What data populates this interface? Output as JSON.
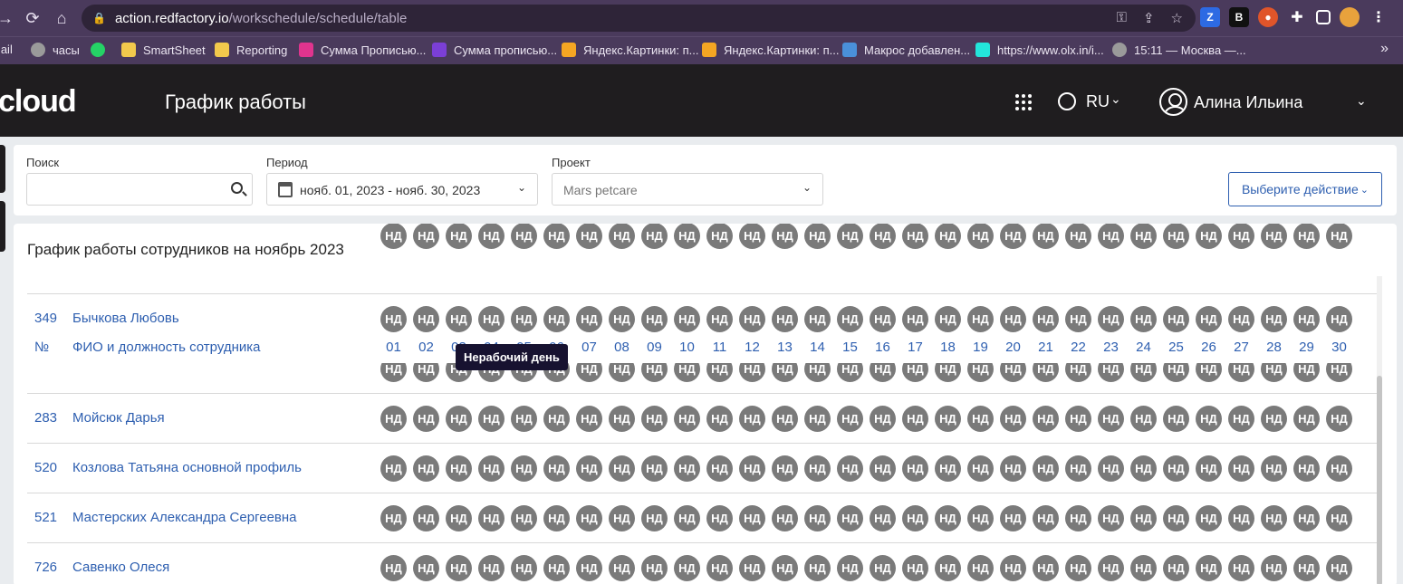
{
  "browser": {
    "url_host": "action.redfactory.io",
    "url_path": "/workschedule/schedule/table",
    "bookmarks": [
      {
        "label": "mail",
        "icon": "mail-icon",
        "color": "#4a3a5c"
      },
      {
        "label": "часы",
        "icon": "clock-icon",
        "color": "#9a9a9a"
      },
      {
        "label": "",
        "icon": "whatsapp-icon",
        "color": "#25d366"
      },
      {
        "label": "SmartSheet",
        "icon": "folder-icon",
        "color": "#f2c94c"
      },
      {
        "label": "Reporting",
        "icon": "folder-icon",
        "color": "#f2c94c"
      },
      {
        "label": "Сумма Прописью...",
        "icon": "sum-icon",
        "color": "#e0348e"
      },
      {
        "label": "Сумма прописью...",
        "icon": "sum-icon",
        "color": "#7b3fd6"
      },
      {
        "label": "Яндекс.Картинки: п...",
        "icon": "yandex-images-icon",
        "color": "#f5a623"
      },
      {
        "label": "Яндекс.Картинки: п...",
        "icon": "yandex-images-icon",
        "color": "#f5a623"
      },
      {
        "label": "Макрос добавлен...",
        "icon": "macro-icon",
        "color": "#4a90d9"
      },
      {
        "label": "https://www.olx.in/i...",
        "icon": "olx-icon",
        "color": "#23e5db"
      },
      {
        "label": "15:11 — Москва —...",
        "icon": "clock-icon",
        "color": "#9a9a9a"
      }
    ],
    "more": "»"
  },
  "header": {
    "logo": "cloud",
    "title": "График работы",
    "lang": "RU",
    "user": "Алина Ильина"
  },
  "filters": {
    "search_label": "Поиск",
    "search_value": "",
    "period_label": "Период",
    "period_value": "нояб. 01, 2023 - нояб. 30, 2023",
    "project_label": "Проект",
    "project_value": "Mars petcare",
    "action_label": "Выберите действие"
  },
  "table": {
    "title": "График работы сотрудников на ноябрь 2023",
    "col_num": "№",
    "col_name": "ФИО и должность сотрудника",
    "days": [
      "01",
      "02",
      "03",
      "04",
      "05",
      "06",
      "07",
      "08",
      "09",
      "10",
      "11",
      "12",
      "13",
      "14",
      "15",
      "16",
      "17",
      "18",
      "19",
      "20",
      "21",
      "22",
      "23",
      "24",
      "25",
      "26",
      "27",
      "28",
      "29",
      "30"
    ],
    "cell_label": "НД",
    "tooltip": "Нерабочий день",
    "rows": [
      {
        "num": "349",
        "name": "Бычкова Любовь"
      },
      {
        "num": "283",
        "name": "Мойсюк Дарья"
      },
      {
        "num": "520",
        "name": "Козлова Татьяна основной профиль"
      },
      {
        "num": "521",
        "name": "Мастерских Александра Сергеевна"
      },
      {
        "num": "726",
        "name": "Савенко Олеся"
      }
    ]
  }
}
